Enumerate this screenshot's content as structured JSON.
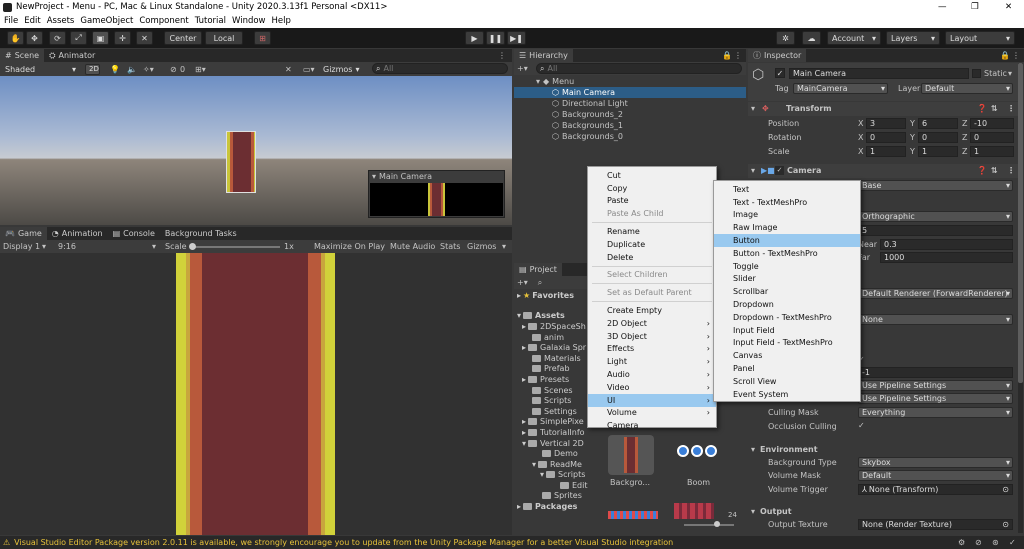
{
  "window": {
    "title": "NewProject - Menu - PC, Mac & Linux Standalone - Unity 2020.3.13f1 Personal <DX11>",
    "controls": [
      "—",
      "❐",
      "✕"
    ]
  },
  "menubar": [
    "File",
    "Edit",
    "Assets",
    "GameObject",
    "Component",
    "Tutorial",
    "Window",
    "Help"
  ],
  "toolbar": {
    "center_label": "Center",
    "local_label": "Local",
    "account": "Account",
    "layers": "Layers",
    "layout": "Layout"
  },
  "scene": {
    "tabs": [
      "Scene",
      "Animator"
    ],
    "shading": "Shaded",
    "mode_2d": "2D",
    "gizmos": "Gizmos",
    "search_placeholder": "All",
    "hidden_count": "0",
    "camera_preview_title": "Main Camera"
  },
  "game": {
    "tabs": [
      "Game",
      "Animation",
      "Console",
      "Background Tasks"
    ],
    "display": "Display 1",
    "aspect": "9:16",
    "scale_label": "Scale",
    "scale_value": "1x",
    "buttons": [
      "Maximize On Play",
      "Mute Audio",
      "Stats",
      "Gizmos"
    ]
  },
  "hierarchy": {
    "title": "Hierarchy",
    "search_placeholder": "All",
    "root": "Menu",
    "items": [
      "Main Camera",
      "Directional Light",
      "Backgrounds_2",
      "Backgrounds_1",
      "Backgrounds_0"
    ]
  },
  "context_menu": {
    "items": [
      {
        "label": "Cut",
        "disabled": false
      },
      {
        "label": "Copy",
        "disabled": false
      },
      {
        "label": "Paste",
        "disabled": false
      },
      {
        "label": "Paste As Child",
        "disabled": true
      },
      {
        "label": "Rename",
        "disabled": false
      },
      {
        "label": "Duplicate",
        "disabled": false
      },
      {
        "label": "Delete",
        "disabled": false
      },
      {
        "label": "Select Children",
        "disabled": true
      },
      {
        "label": "Set as Default Parent",
        "disabled": true
      },
      {
        "label": "Create Empty",
        "disabled": false
      },
      {
        "label": "2D Object",
        "disabled": false
      },
      {
        "label": "3D Object",
        "disabled": false
      },
      {
        "label": "Effects",
        "disabled": false
      },
      {
        "label": "Light",
        "disabled": false
      },
      {
        "label": "Audio",
        "disabled": false
      },
      {
        "label": "Video",
        "disabled": false
      },
      {
        "label": "UI",
        "disabled": false
      },
      {
        "label": "Volume",
        "disabled": false
      },
      {
        "label": "Camera",
        "disabled": false
      }
    ]
  },
  "ui_submenu": {
    "items": [
      "Text",
      "Text - TextMeshPro",
      "Image",
      "Raw Image",
      "Button",
      "Button - TextMeshPro",
      "Toggle",
      "Slider",
      "Scrollbar",
      "Dropdown",
      "Dropdown - TextMeshPro",
      "Input Field",
      "Input Field - TextMeshPro",
      "Canvas",
      "Panel",
      "Scroll View",
      "Event System"
    ],
    "selected": "Button"
  },
  "project": {
    "title": "Project",
    "favorites": "Favorites",
    "assets": "Assets",
    "folders": [
      "2DSpaceSh",
      "anim",
      "Galaxia Spr",
      "Materials",
      "Prefab",
      "Presets",
      "Scenes",
      "Scripts",
      "Settings",
      "SimplePixe",
      "TutorialInfo",
      "Vertical 2D",
      "Demo",
      "ReadMe",
      "Scripts",
      "Edit",
      "Sprites"
    ],
    "packages": "Packages",
    "thumbs": [
      "Backgro...",
      "Boom"
    ],
    "count": "24"
  },
  "inspector": {
    "title": "Inspector",
    "object_name": "Main Camera",
    "static_label": "Static",
    "tag_label": "Tag",
    "tag_value": "MainCamera",
    "layer_label": "Layer",
    "layer_value": "Default",
    "transform": {
      "title": "Transform",
      "position_label": "Position",
      "position": [
        "3",
        "6",
        "-10"
      ],
      "rotation_label": "Rotation",
      "rotation": [
        "0",
        "0",
        "0"
      ],
      "scale_label": "Scale",
      "scale": [
        "1",
        "1",
        "1"
      ]
    },
    "camera": {
      "title": "Camera",
      "render_type": "Base",
      "projection": "Orthographic",
      "size": "5",
      "near_label": "Near",
      "near": "0.3",
      "far_label": "Far",
      "far": "1000",
      "renderer": "Default Renderer (ForwardRenderer)",
      "post_aa": "None",
      "priority": "-1",
      "opaque_texture": "Use Pipeline Settings",
      "depth_texture": "Use Pipeline Settings",
      "culling_mask_label": "Culling Mask",
      "culling_mask": "Everything",
      "occlusion_label": "Occlusion Culling"
    },
    "environment": {
      "title": "Environment",
      "bg_type_label": "Background Type",
      "bg_type": "Skybox",
      "volume_mask_label": "Volume Mask",
      "volume_mask": "Default",
      "volume_trigger_label": "Volume Trigger",
      "volume_trigger": "None (Transform)"
    },
    "output": {
      "title": "Output",
      "texture_label": "Output Texture",
      "texture": "None (Render Texture)"
    }
  },
  "statusbar": {
    "message": "Visual Studio Editor Package version 2.0.11 is available, we strongly encourage you to update from the Unity Package Manager for a better Visual Studio integration"
  }
}
